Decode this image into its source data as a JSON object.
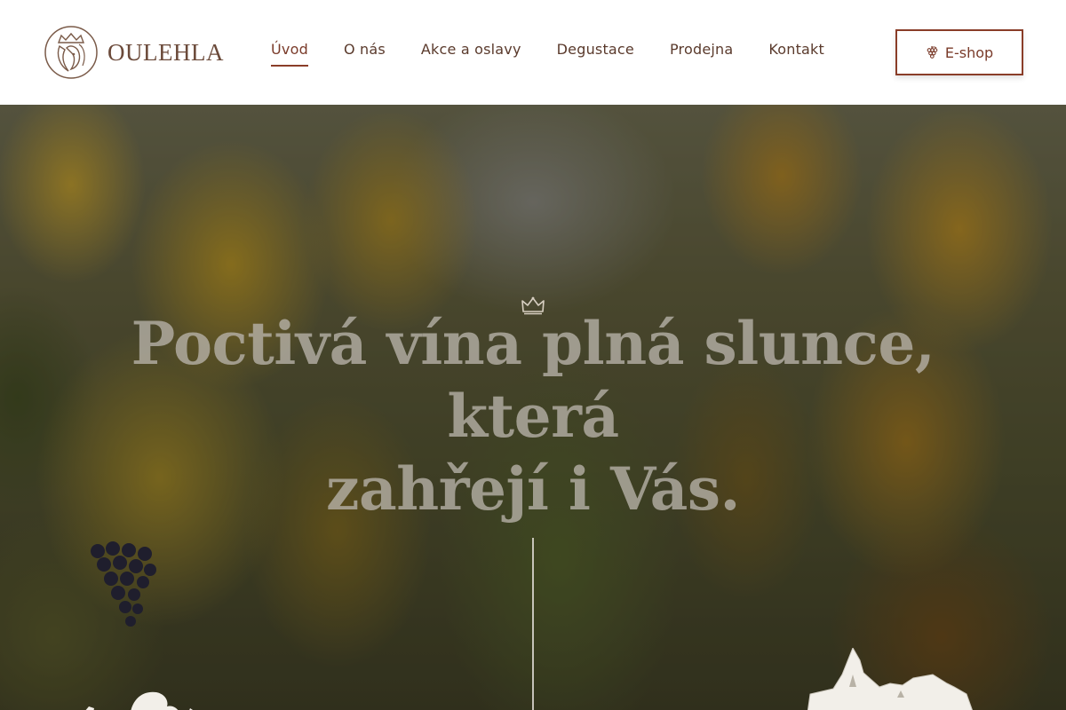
{
  "header": {
    "logo_text": "OULEHLA",
    "logo_icon": "crest-icon",
    "nav": [
      {
        "label": "Úvod",
        "active": true
      },
      {
        "label": "O nás",
        "active": false
      },
      {
        "label": "Akce a oslavy",
        "active": false
      },
      {
        "label": "Degustace",
        "active": false
      },
      {
        "label": "Prodejna",
        "active": false
      },
      {
        "label": "Kontakt",
        "active": false
      }
    ],
    "eshop_label": "E-shop",
    "eshop_icon": "grape-icon"
  },
  "hero": {
    "title_line1": "Poctivá vína plná slunce, která",
    "title_line2": "zahřejí i Vás.",
    "crown_icon": "crown-icon"
  },
  "colors": {
    "accent": "#8a3d28",
    "nav_text": "#5a3a2c",
    "logo_text": "#6b4a3a"
  }
}
